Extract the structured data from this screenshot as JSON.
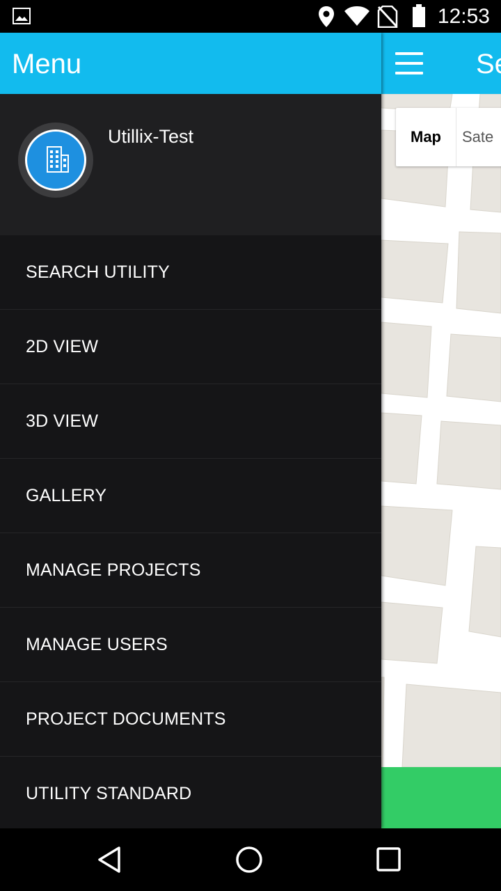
{
  "status_bar": {
    "time": "12:53",
    "icons": [
      "image-notification-icon",
      "location-icon",
      "wifi-icon",
      "no-sim-icon",
      "battery-icon"
    ]
  },
  "drawer": {
    "title": "Menu",
    "profile_name": "Utillix-Test",
    "avatar_icon": "building-icon",
    "items": [
      {
        "label": "SEARCH UTILITY"
      },
      {
        "label": "2D VIEW"
      },
      {
        "label": "3D VIEW"
      },
      {
        "label": "GALLERY"
      },
      {
        "label": "MANAGE PROJECTS"
      },
      {
        "label": "MANAGE USERS"
      },
      {
        "label": "PROJECT DOCUMENTS"
      },
      {
        "label": "UTILITY STANDARD"
      }
    ]
  },
  "screen": {
    "title_partial": "Se",
    "map_toggle": {
      "map": "Map",
      "satellite_partial": "Sate"
    }
  },
  "nav_bar": {
    "icons": [
      "back-icon",
      "home-icon",
      "recents-icon"
    ]
  },
  "colors": {
    "header": "#12bbee",
    "drawer_bg": "#151517",
    "profile_bg": "#1f1f21",
    "avatar": "#1e90e0",
    "green_bar": "#33cc66",
    "map_block": "#e8e5df"
  }
}
